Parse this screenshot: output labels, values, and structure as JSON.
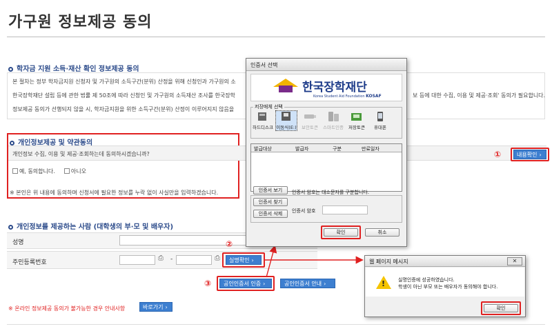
{
  "page": {
    "title": "가구원 정보제공 동의"
  },
  "section1": {
    "title": "학자금 지원 소득·재산 확인 정보제공 동의",
    "lines": [
      "본 절차는 정부 학자금지원 신청자 및 가구원의 소득구간(분위) 산정을 위해 신청인과 가구원의 소",
      "한국장학재단 설립 등에 관한 법률 제 50조에 따라 신청인 및 가구원의 소득재산 조사를 한국장학",
      "정보제공 동의가 선행되지 않을 시, 학자금지원을 위한 소득구간(분위) 산정이 이루어지지 않음을"
    ],
    "line2_tail": "보 등에 대한 수집, 이용 및 제공·조회' 동의가 필요합니다."
  },
  "section2": {
    "title": "개인정보제공 및 약관동의",
    "question": "개인정보 수집, 이용 및 제공·조회하는데 동의하시겠습니까?",
    "agree_label": "예, 동의합니다.",
    "disagree_label": "아니오",
    "notice": "※ 본인은 위 내용에 동의하며 신청서에 필요한 정보를 누락 없이 사실만을 입력하겠습니다.",
    "detail_button": "내용확인",
    "step_marker": "①"
  },
  "section3": {
    "title": "개인정보를 제공하는 사람 (대학생의 부·모 및 배우자)",
    "name_label": "성명",
    "rrn_label": "주민등록번호",
    "rrn_separator": "-",
    "verify_button": "실명확인",
    "step2_marker": "②",
    "cert_button": "공인인증서 인증",
    "cert_guide_button": "공인인증서 안내",
    "step3_marker": "③"
  },
  "footer": {
    "notice": "※ 온라인 정보제공 동의가 불가능한 경우 안내사항",
    "shortcut_button": "바로가기"
  },
  "cert_dialog": {
    "title": "인증서 선택",
    "logo_text": "한국장학재단",
    "logo_sub": "Korea Student Aid Foundation",
    "logo_abbr": "KOSAF",
    "storage_group_label": "저장매체 선택",
    "media": [
      {
        "label": "하드디스크",
        "icon": "hard-disk-icon",
        "state": "normal"
      },
      {
        "label": "이동식(E:)",
        "icon": "removable-disk-icon",
        "state": "selected"
      },
      {
        "label": "보안토큰",
        "icon": "security-token-icon",
        "state": "disabled"
      },
      {
        "label": "스마트인증",
        "icon": "smart-cert-icon",
        "state": "disabled"
      },
      {
        "label": "저장토큰",
        "icon": "storage-token-icon",
        "state": "normal"
      },
      {
        "label": "휴대폰",
        "icon": "mobile-phone-icon",
        "state": "normal"
      }
    ],
    "columns": [
      "발급대상",
      "발급자",
      "구분",
      "만료일자"
    ],
    "view_cert_button": "인증서 보기",
    "find_cert_button": "인증서 찾기",
    "delete_cert_button": "인증서 삭제",
    "case_notice": "인증서 암호는 대소문자를 구분합니다.",
    "password_label": "인증서 암호",
    "password_value": "",
    "ok_button": "확인",
    "cancel_button": "취소"
  },
  "message_dialog": {
    "title": "웹 페이지 메시지",
    "close_glyph": "✕",
    "line1": "실명인증에 성공하였습니다.",
    "line2": "학생이 아닌 부모 또는 배우자가 동의해야 합니다.",
    "ok_button": "확인"
  },
  "colors": {
    "accent_blue": "#3d7fd0",
    "highlight_red": "#e02020",
    "section_title": "#2b4a8a"
  }
}
